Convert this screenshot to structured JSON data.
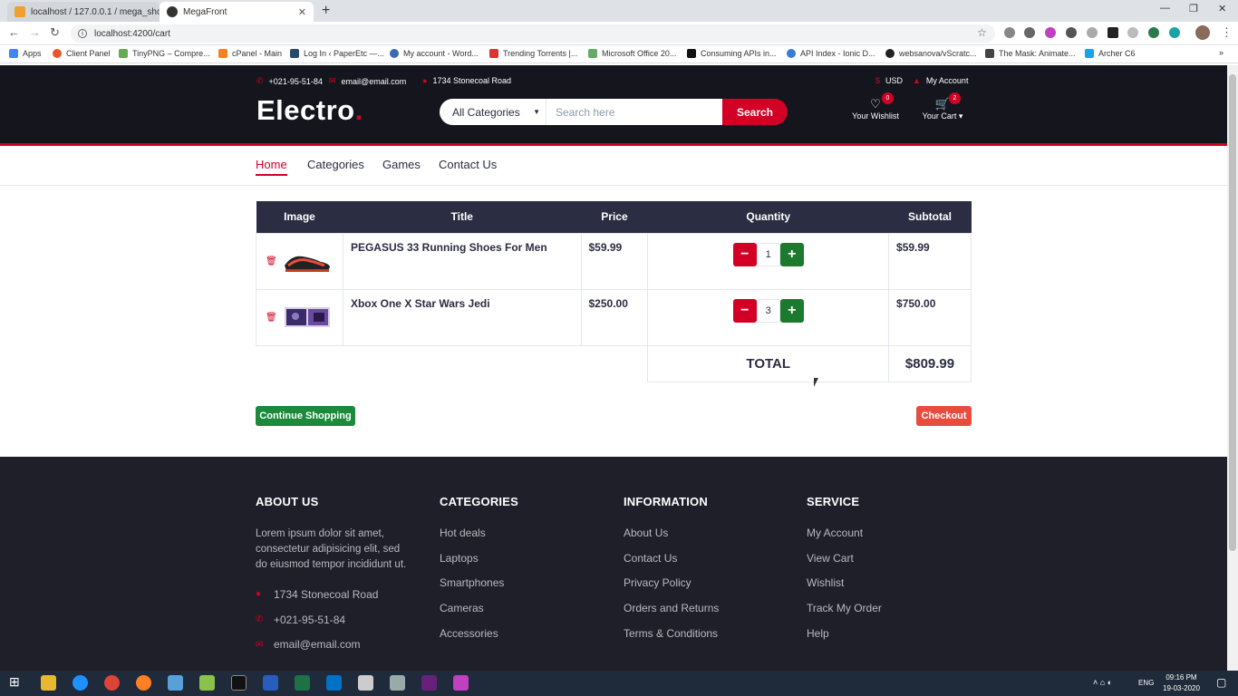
{
  "browser": {
    "tabs": [
      {
        "title": "localhost / 127.0.0.1 / mega_sho",
        "active": false
      },
      {
        "title": "MegaFront",
        "active": true
      }
    ],
    "url": "localhost:4200/cart",
    "bookmarks": [
      "Apps",
      "Client Panel",
      "TinyPNG – Compre...",
      "cPanel - Main",
      "Log In ‹ PaperEtc —...",
      "My account - Word...",
      "Trending Torrents |...",
      "Microsoft Office 20...",
      "Consuming APIs in...",
      "API Index - Ionic D...",
      "websanova/vScratc...",
      "The Mask: Animate...",
      "Archer C6"
    ]
  },
  "header": {
    "phone": "+021-95-51-84",
    "email": "email@email.com",
    "address": "1734 Stonecoal Road",
    "currency": "USD",
    "account": "My Account",
    "logo_text": "Electro",
    "logo_dot": ".",
    "category_select": "All Categories",
    "search_placeholder": "Search here",
    "search_button": "Search",
    "wishlist_label": "Your Wishlist",
    "wishlist_count": "0",
    "cart_label": "Your Cart",
    "cart_count": "2"
  },
  "nav": {
    "items": [
      "Home",
      "Categories",
      "Games",
      "Contact Us"
    ],
    "active": "Home"
  },
  "cart": {
    "columns": [
      "Image",
      "Title",
      "Price",
      "Quantity",
      "Subtotal"
    ],
    "items": [
      {
        "title": "PEGASUS 33 Running Shoes For Men",
        "price": "$59.99",
        "quantity": "1",
        "subtotal": "$59.99"
      },
      {
        "title": "Xbox One X Star Wars Jedi",
        "price": "$250.00",
        "quantity": "3",
        "subtotal": "$750.00"
      }
    ],
    "total_label": "TOTAL",
    "total_value": "$809.99",
    "continue_button": "Continue Shopping",
    "checkout_button": "Checkout"
  },
  "footer": {
    "about": {
      "heading": "ABOUT US",
      "text": "Lorem ipsum dolor sit amet, consectetur adipisicing elit, sed do eiusmod tempor incididunt ut.",
      "address": "1734 Stonecoal Road",
      "phone": "+021-95-51-84",
      "email": "email@email.com"
    },
    "categories": {
      "heading": "CATEGORIES",
      "items": [
        "Hot deals",
        "Laptops",
        "Smartphones",
        "Cameras",
        "Accessories"
      ]
    },
    "information": {
      "heading": "INFORMATION",
      "items": [
        "About Us",
        "Contact Us",
        "Privacy Policy",
        "Orders and Returns",
        "Terms & Conditions"
      ]
    },
    "service": {
      "heading": "SERVICE",
      "items": [
        "My Account",
        "View Cart",
        "Wishlist",
        "Track My Order",
        "Help"
      ]
    }
  },
  "taskbar": {
    "language": "ENG",
    "time": "09:16 PM",
    "date": "19-03-2020"
  },
  "colors": {
    "accent": "#d10024",
    "dark": "#15161d",
    "footer": "#1e1f29",
    "plus": "#1b7a2e",
    "continue": "#1b8a3a",
    "checkout": "#e84c3d"
  }
}
